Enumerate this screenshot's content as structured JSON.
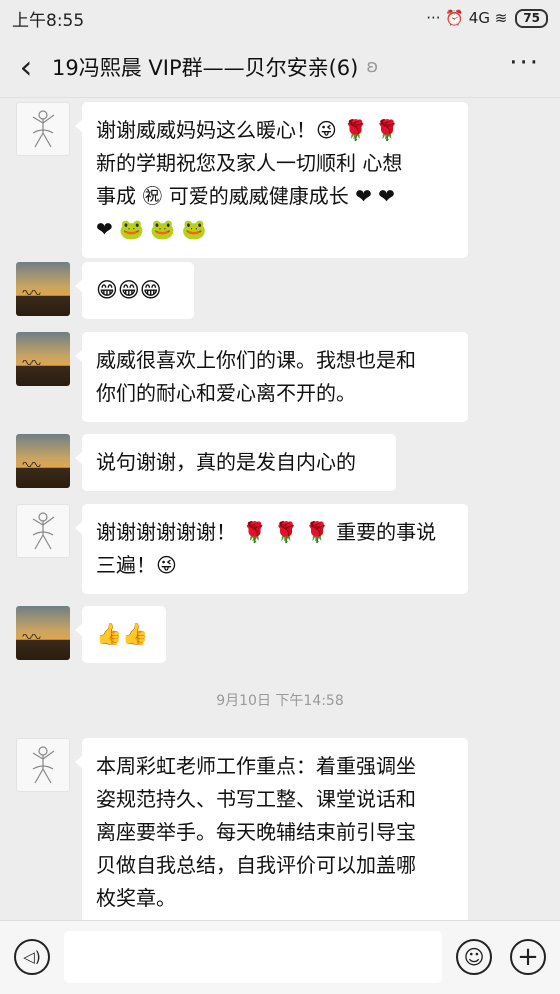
{
  "status_bar": {
    "time": "上午8:55",
    "indicators": "··· ⏰ 4G ≋",
    "battery": "75"
  },
  "header": {
    "back_icon": "‹",
    "title": "19冯熙晨 VIP群——贝尔安亲(6)",
    "ear_icon": "ʚ",
    "more_icon": "···"
  },
  "messages": [
    {
      "avatar": "dancer",
      "lines": [
        "谢谢威威妈妈这么暖心！😜 🌹 🌹",
        "新的学期祝您及家人一切顺利 心想",
        "事成 ㊗ 可爱的威威健康成长 ❤ ❤",
        "❤ 🐸 🐸 🐸"
      ]
    },
    {
      "avatar": "desert",
      "lines": [
        "😁😁😁"
      ]
    },
    {
      "avatar": "desert",
      "lines": [
        "威威很喜欢上你们的课。我想也是和",
        "你们的耐心和爱心离不开的。"
      ]
    },
    {
      "avatar": "desert",
      "lines": [
        "说句谢谢，真的是发自内心的"
      ]
    },
    {
      "avatar": "dancer",
      "lines": [
        "谢谢谢谢谢谢！ 🌹 🌹 🌹 重要的事说",
        "三遍！😜"
      ]
    },
    {
      "avatar": "desert",
      "lines": [
        "👍👍"
      ]
    },
    {
      "avatar": "dancer",
      "lines": [
        "本周彩虹老师工作重点：着重强调坐",
        "姿规范持久、书写工整、课堂说话和",
        "离座要举手。每天晚辅结束前引导宝",
        "贝做自我总结，自我评价可以加盖哪",
        "枚奖章。"
      ]
    }
  ],
  "timestamp": "9月10日 下午14:58",
  "input_bar": {
    "voice_icon": "◁)",
    "emoji_icon": "☺",
    "plus_icon": "+",
    "placeholder": ""
  }
}
